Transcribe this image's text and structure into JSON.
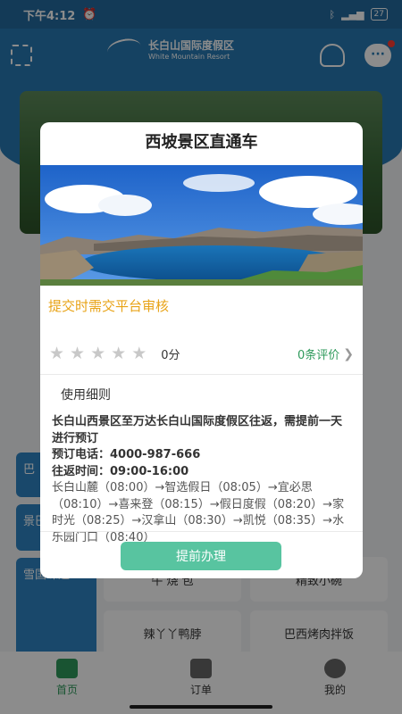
{
  "status_bar": {
    "time": "下午4:12",
    "battery": "27"
  },
  "header": {
    "resort_name": "长白山国际度假区",
    "resort_name_en": "White Mountain Resort"
  },
  "side_tiles": [
    "巴",
    "景巴",
    "雪国味道"
  ],
  "food_items": [
    "牛 烧 包",
    "精致小碗",
    "辣丫丫鸭脖",
    "巴西烤肉拌饭"
  ],
  "tabbar": {
    "items": [
      {
        "label": "首页"
      },
      {
        "label": "订单"
      },
      {
        "label": "我的"
      }
    ]
  },
  "modal": {
    "title": "西坡景区直通车",
    "notice": "提交时需交平台审核",
    "rating": {
      "score_text": "0分",
      "reviews_text": "0条评价",
      "stars_filled": 0,
      "stars_total": 5
    },
    "section_title": "使用细则",
    "description": "长白山西景区至万达长白山国际度假区往返，需提前一天进行预订",
    "phone": "预订电话：4000-987-666",
    "hours": "往返时间：09:00-16:00",
    "route": "长白山麓（08:00）→智选假日（08:05）→宜必思（08:10）→喜来登（08:15）→假日度假（08:20）→家时光（08:25）→汉拿山（08:30）→凯悦（08:35）→水乐园门口（08:40）",
    "button_label": "提前办理"
  },
  "colors": {
    "accent_green": "#58c4a0",
    "notice_orange": "#e8a317",
    "primary_blue": "#2778b2"
  }
}
